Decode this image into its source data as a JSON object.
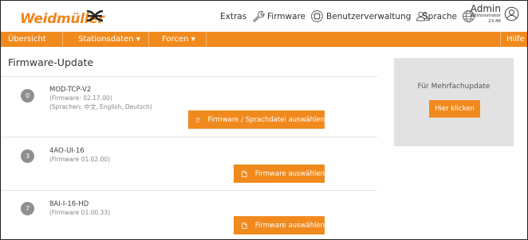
{
  "brand": {
    "name": "Weidmüller",
    "color": "#f18a1d"
  },
  "topnav": {
    "extras": {
      "label": "Extras",
      "icon": "wrench-icon"
    },
    "firmware": {
      "label": "Firmware",
      "icon": "firmware-chip-icon"
    },
    "users": {
      "label": "Benutzerverwaltung",
      "icon": "users-icon"
    },
    "language": {
      "label": "Sprache",
      "icon": "globe-icon"
    }
  },
  "user": {
    "name": "Admin",
    "role": "Administrator",
    "time": "23:46",
    "icon": "user-circle-icon"
  },
  "menu": {
    "overview": "Übersicht",
    "station_data": "Stationsdaten ▾",
    "force": "Forcen ▾",
    "help": "Hilfe"
  },
  "page": {
    "title": "Firmware-Update"
  },
  "devices": [
    {
      "slot": "0",
      "name": "MOD-TCP-V2",
      "firmware": "(Firmware: 02.17.00)",
      "languages": "(Sprachen: 中文, English, Deutsch)",
      "button": "Firmware / Sprachdatei auswählen"
    },
    {
      "slot": "3",
      "name": "4AO-UI-16",
      "firmware": "(Firmware 01.02.00)",
      "button": "Firmware auswählen"
    },
    {
      "slot": "7",
      "name": "8AI-I-16-HD",
      "firmware": "(Firmware 01.00.33)",
      "button": "Firmware auswählen"
    }
  ],
  "multi_update": {
    "label": "Für Mehrfachupdate",
    "button": "Hier klicken"
  }
}
